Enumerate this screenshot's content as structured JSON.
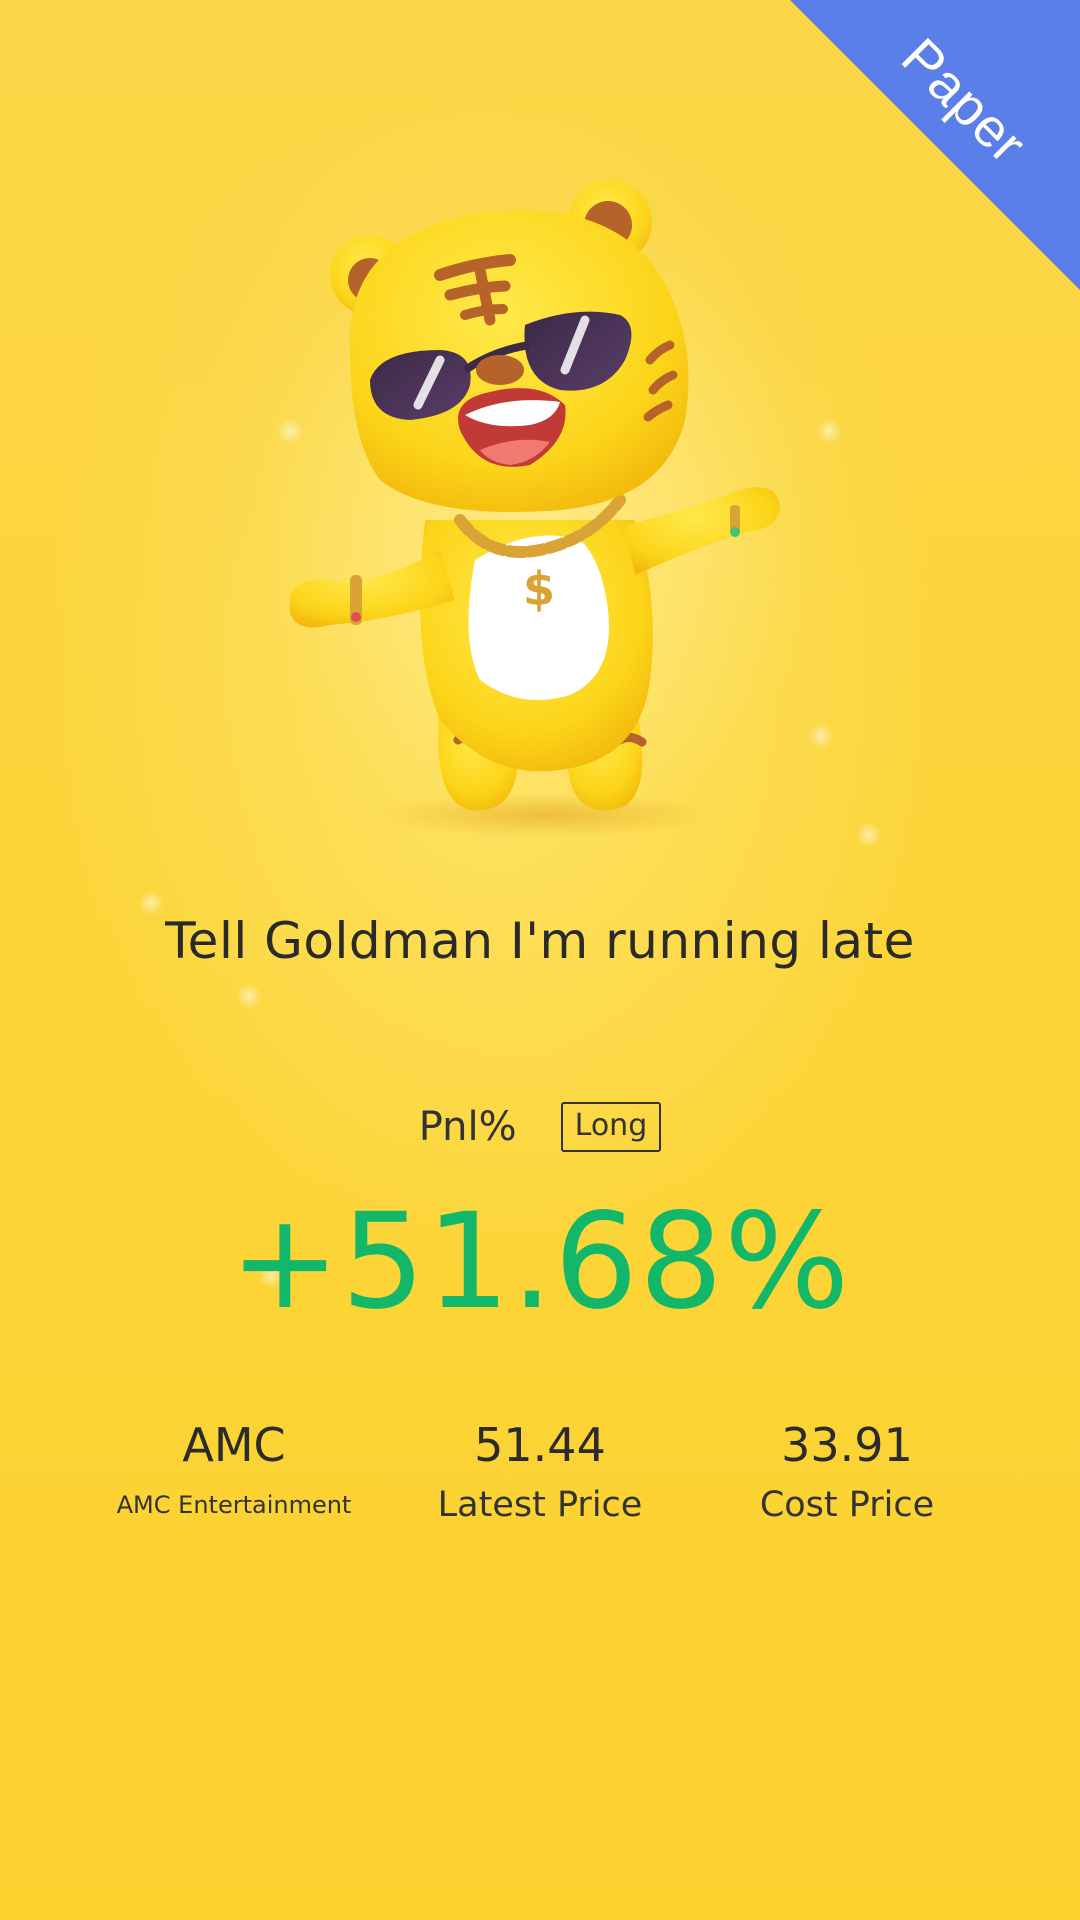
{
  "badge": {
    "label": "Paper",
    "color": "#5b7fe8",
    "icon": "corner-ribbon"
  },
  "mascot": {
    "icon": "tiger-mascot-icon"
  },
  "headline": "Tell Goldman I'm running late",
  "pnl": {
    "label": "Pnl%",
    "direction": "Long",
    "value": "+51.68%",
    "color": "#12b76a"
  },
  "stats": {
    "symbol": "AMC",
    "company": "AMC Entertainment",
    "latest_price": "51.44",
    "latest_price_label": "Latest Price",
    "cost_price": "33.91",
    "cost_price_label": "Cost Price"
  },
  "colors": {
    "background": "#fcd53a",
    "text": "#2b2b2b"
  }
}
